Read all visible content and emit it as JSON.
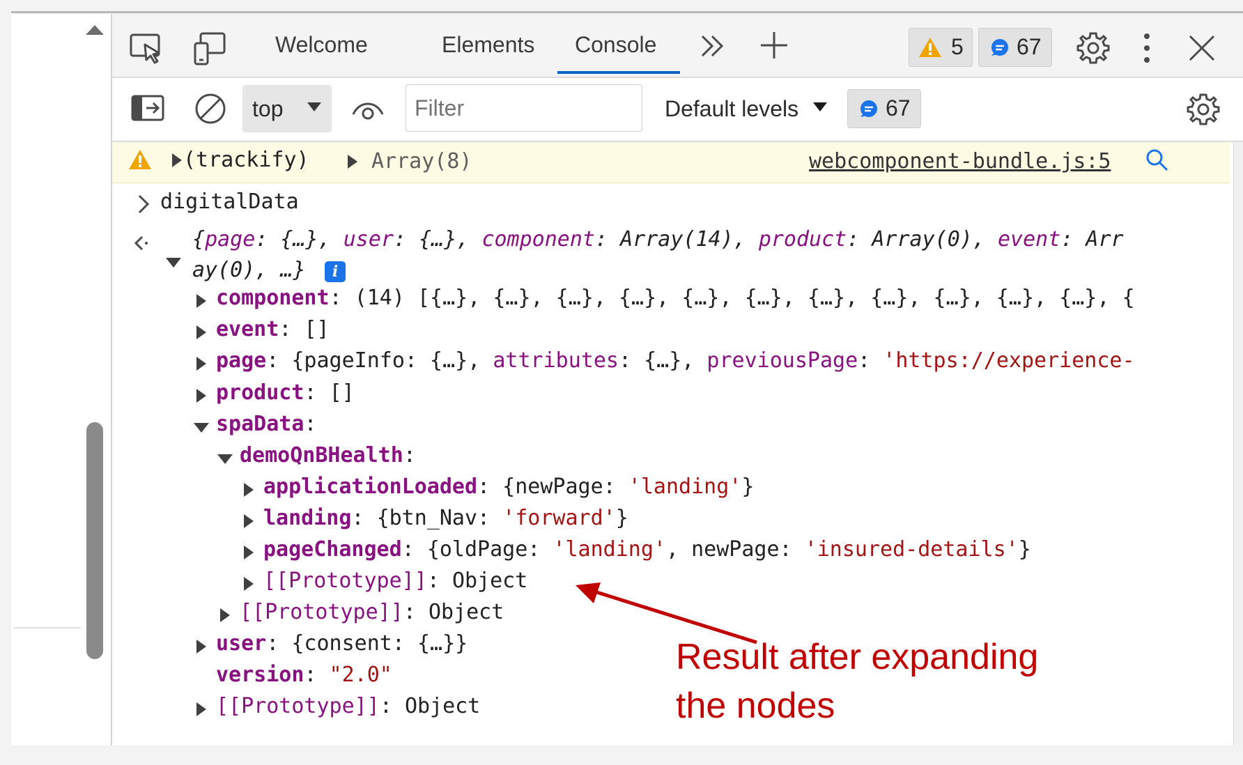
{
  "tabs": [
    "Welcome",
    "Elements",
    "Console"
  ],
  "active_tab": "Console",
  "badges": {
    "warnings": "5",
    "messages": "67"
  },
  "toolbar": {
    "context": "top",
    "filter_placeholder": "Filter",
    "levels": "Default levels",
    "message_count": "67"
  },
  "console": {
    "warning": {
      "label": "(trackify)",
      "value": "Array(8)",
      "source": "webcomponent-bundle.js:5"
    },
    "input": "digitalData",
    "result_summary": [
      {
        "text": "{",
        "kind": "plain"
      },
      {
        "text": "page",
        "kind": "key"
      },
      {
        "text": ": {…}, ",
        "kind": "plain"
      },
      {
        "text": "user",
        "kind": "key"
      },
      {
        "text": ": {…}, ",
        "kind": "plain"
      },
      {
        "text": "component",
        "kind": "key"
      },
      {
        "text": ": Array(14), ",
        "kind": "plain"
      },
      {
        "text": "product",
        "kind": "key"
      },
      {
        "text": ": Array(0), ",
        "kind": "plain"
      },
      {
        "text": "event",
        "kind": "key"
      },
      {
        "text": ": Arr",
        "kind": "plain"
      }
    ],
    "result_summary_line2": "ay(0), …}",
    "tree": [
      {
        "key": "component",
        "rest": [
          {
            "t": "(14) [{…}, {…}, {…}, {…}, {…}, {…}, {…}, {…}, {…}, {…}, {…}, {",
            "k": "plain"
          }
        ]
      },
      {
        "key": "event",
        "rest": [
          {
            "t": "[]",
            "k": "plain"
          }
        ]
      },
      {
        "key": "page",
        "rest": [
          {
            "t": "{pageInfo: {…}, ",
            "k": "plain"
          },
          {
            "t": "attributes",
            "k": "kv"
          },
          {
            "t": ": {…}, ",
            "k": "plain"
          },
          {
            "t": "previousPage",
            "k": "kv"
          },
          {
            "t": ": ",
            "k": "plain"
          },
          {
            "t": "'https://experience-",
            "k": "str"
          }
        ]
      },
      {
        "key": "product",
        "rest": [
          {
            "t": "[]",
            "k": "plain"
          }
        ]
      },
      {
        "key": "spaData",
        "rest": []
      },
      {
        "key": "demoQnBHealth",
        "rest": []
      },
      {
        "key": "applicationLoaded",
        "rest": [
          {
            "t": "{newPage: ",
            "k": "plain"
          },
          {
            "t": "'landing'",
            "k": "str"
          },
          {
            "t": "}",
            "k": "plain"
          }
        ]
      },
      {
        "key": "landing",
        "rest": [
          {
            "t": "{btn_Nav: ",
            "k": "plain"
          },
          {
            "t": "'forward'",
            "k": "str"
          },
          {
            "t": "}",
            "k": "plain"
          }
        ]
      },
      {
        "key": "pageChanged",
        "rest": [
          {
            "t": "{oldPage: ",
            "k": "plain"
          },
          {
            "t": "'landing'",
            "k": "str"
          },
          {
            "t": ", newPage: ",
            "k": "plain"
          },
          {
            "t": "'insured-details'",
            "k": "str"
          },
          {
            "t": "}",
            "k": "plain"
          }
        ]
      },
      {
        "key": "[[Prototype]]",
        "rest": [
          {
            "t": "Object",
            "k": "plain"
          }
        ]
      },
      {
        "key": "[[Prototype]]",
        "rest": [
          {
            "t": "Object",
            "k": "plain"
          }
        ]
      },
      {
        "key": "user",
        "rest": [
          {
            "t": "{consent: {…}}",
            "k": "plain"
          }
        ]
      },
      {
        "key": "version",
        "rest": [
          {
            "t": "\"2.0\"",
            "k": "str"
          }
        ]
      },
      {
        "key": "[[Prototype]]",
        "rest": [
          {
            "t": "Object",
            "k": "plain"
          }
        ]
      }
    ]
  },
  "annotation": {
    "line1": "Result after expanding",
    "line2": "the nodes",
    "color": "#c00000"
  },
  "colors": {
    "accent": "#0a64c4",
    "warning_bg": "#fefbe5",
    "key": "#881280",
    "string": "#a31515"
  }
}
